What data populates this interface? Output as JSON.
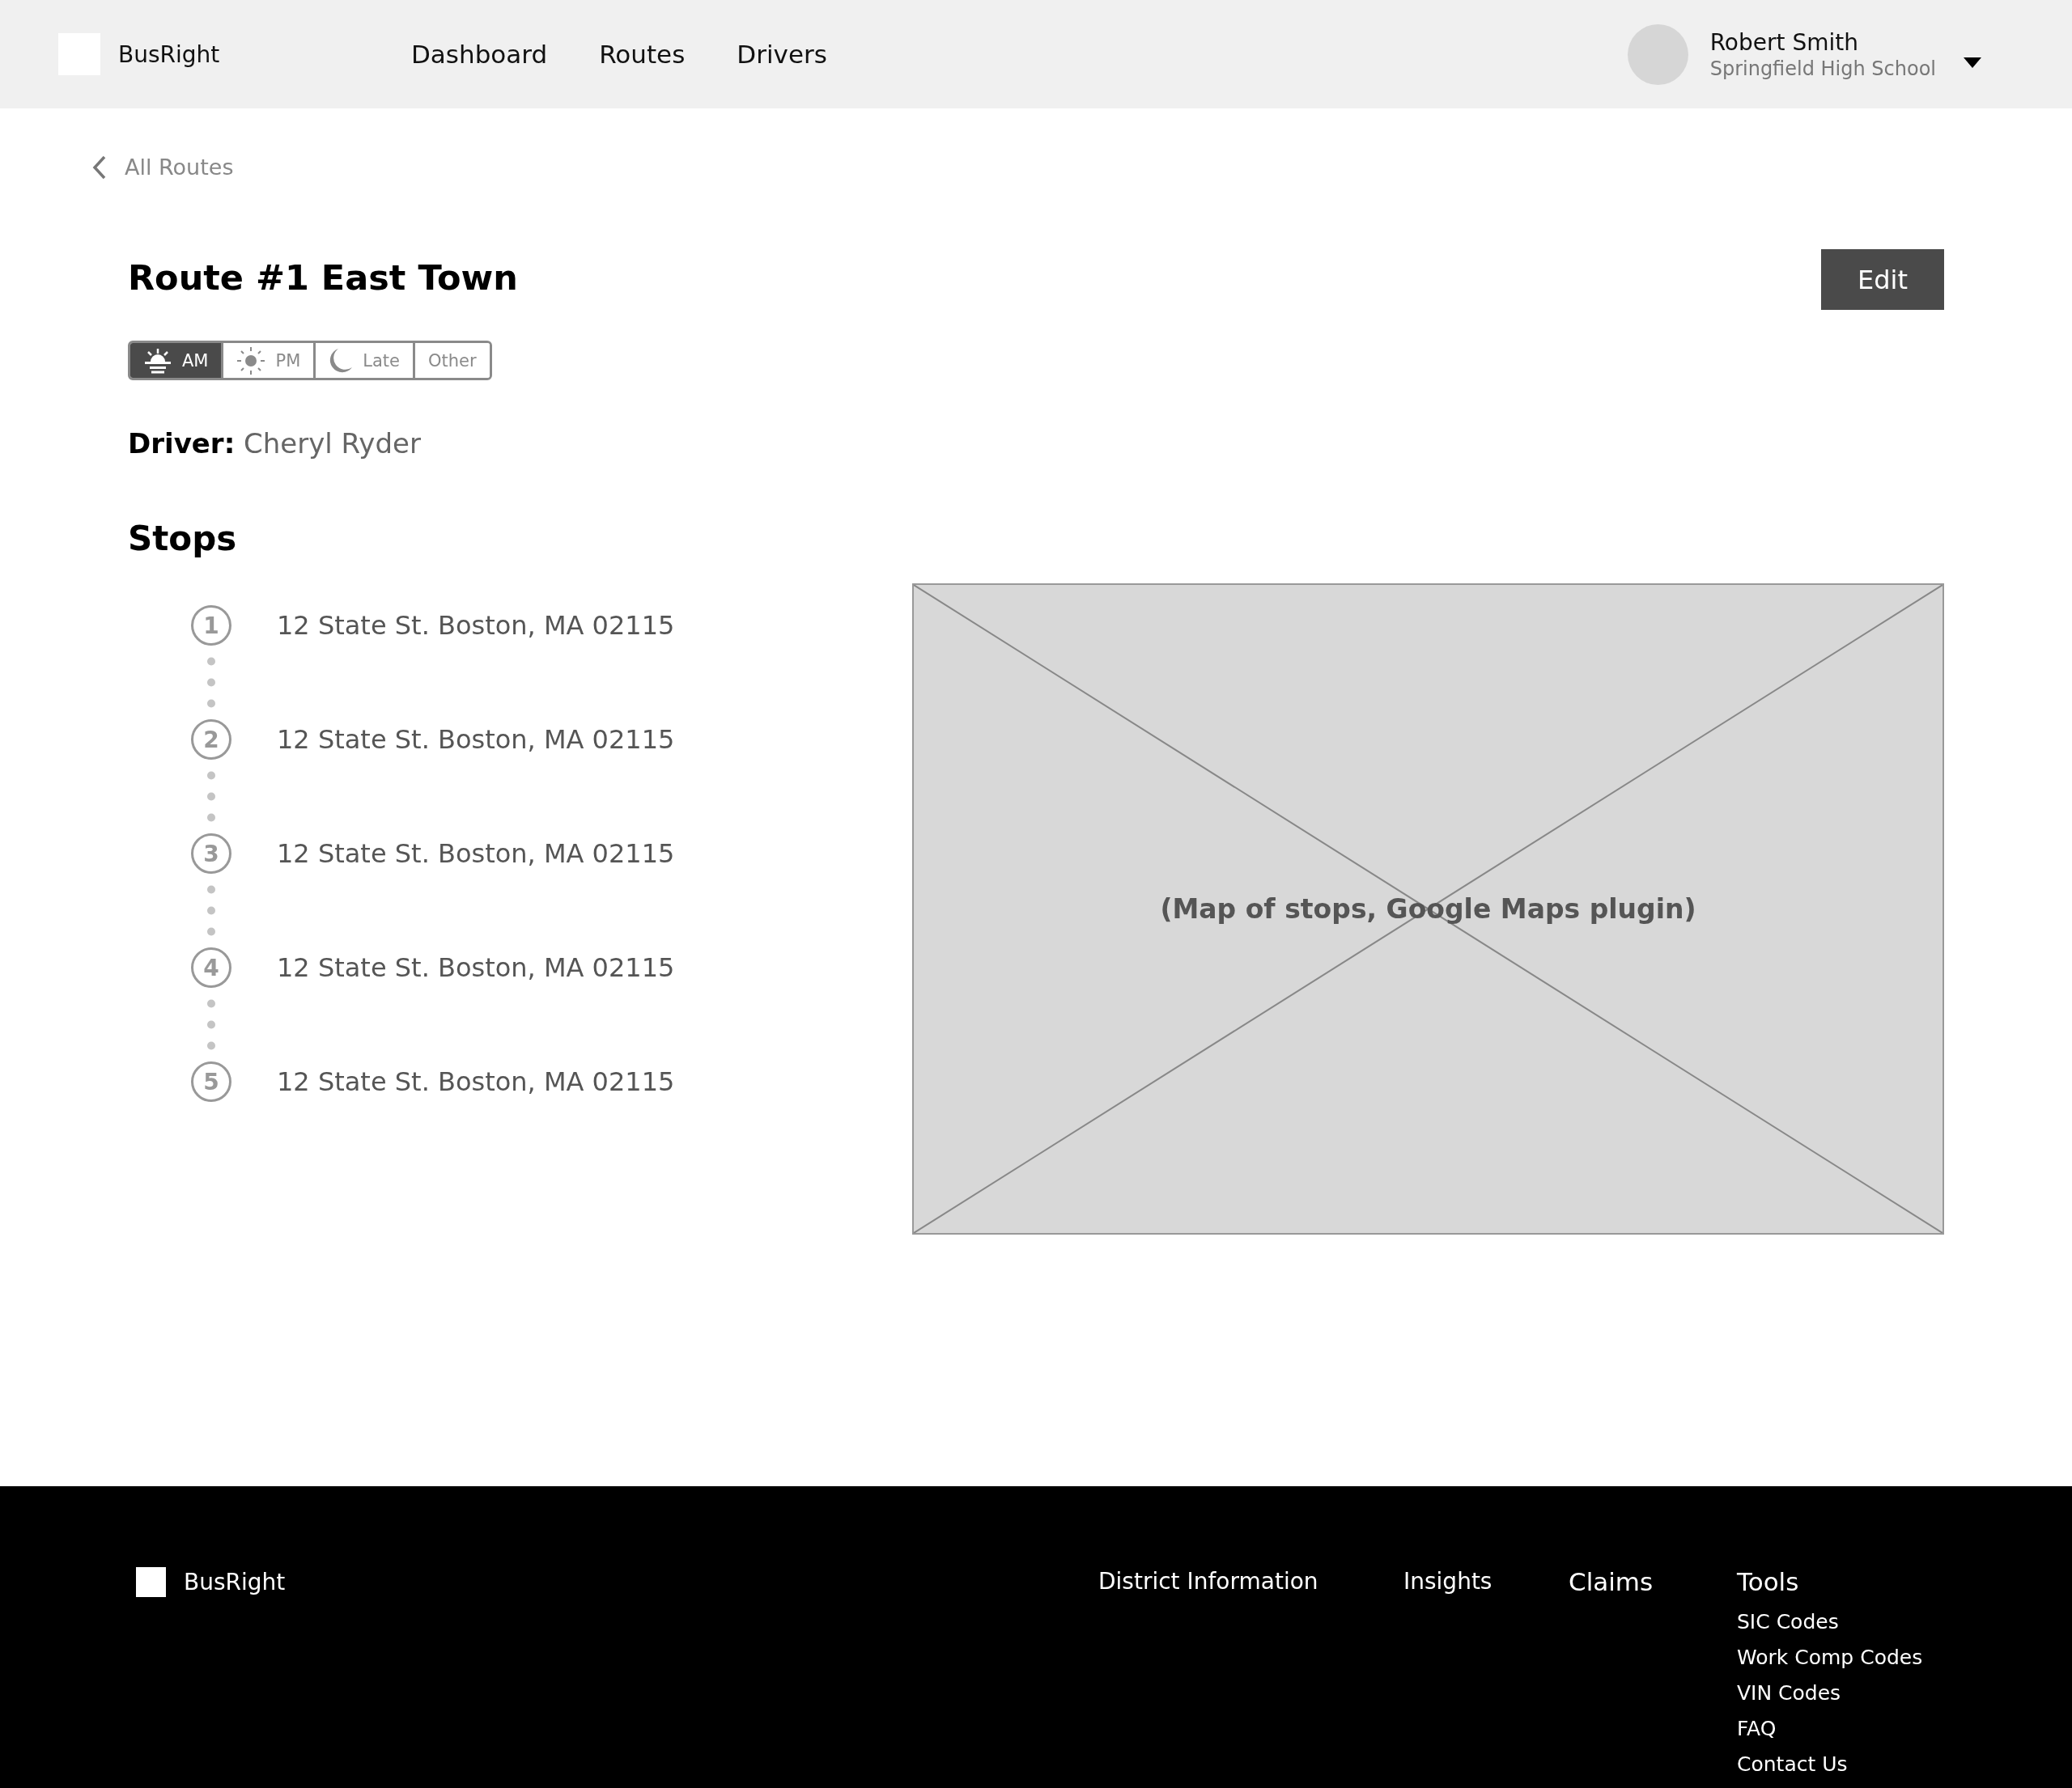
{
  "header": {
    "brand": "BusRight",
    "nav": [
      {
        "label": "Dashboard"
      },
      {
        "label": "Routes"
      },
      {
        "label": "Drivers"
      }
    ],
    "user": {
      "name": "Robert Smith",
      "school": "Springfield High School"
    }
  },
  "back_link": "All Routes",
  "title": "Route #1 East Town",
  "edit_button": "Edit",
  "time_tabs": [
    {
      "label": "AM",
      "kind": "sunrise",
      "selected": true
    },
    {
      "label": "PM",
      "kind": "sun",
      "selected": false
    },
    {
      "label": "Late",
      "kind": "moon",
      "selected": false
    },
    {
      "label": "Other",
      "kind": "none",
      "selected": false
    }
  ],
  "driver": {
    "label": "Driver:",
    "name": "Cheryl Ryder"
  },
  "stops_heading": "Stops",
  "stops": [
    {
      "number": "1",
      "address": "12 State St. Boston, MA 02115"
    },
    {
      "number": "2",
      "address": "12 State St. Boston, MA 02115"
    },
    {
      "number": "3",
      "address": "12 State St. Boston, MA 02115"
    },
    {
      "number": "4",
      "address": "12 State St. Boston, MA 02115"
    },
    {
      "number": "5",
      "address": "12 State St. Boston, MA 02115"
    }
  ],
  "map_placeholder": "(Map of stops, Google Maps plugin)",
  "footer": {
    "brand": "BusRight",
    "columns": [
      {
        "heading": "District Information"
      },
      {
        "heading": "Insights"
      },
      {
        "heading": "Claims"
      },
      {
        "heading": "Tools",
        "links": [
          "SIC Codes",
          "Work Comp Codes",
          "VIN Codes",
          "FAQ",
          "Contact Us"
        ]
      }
    ]
  }
}
